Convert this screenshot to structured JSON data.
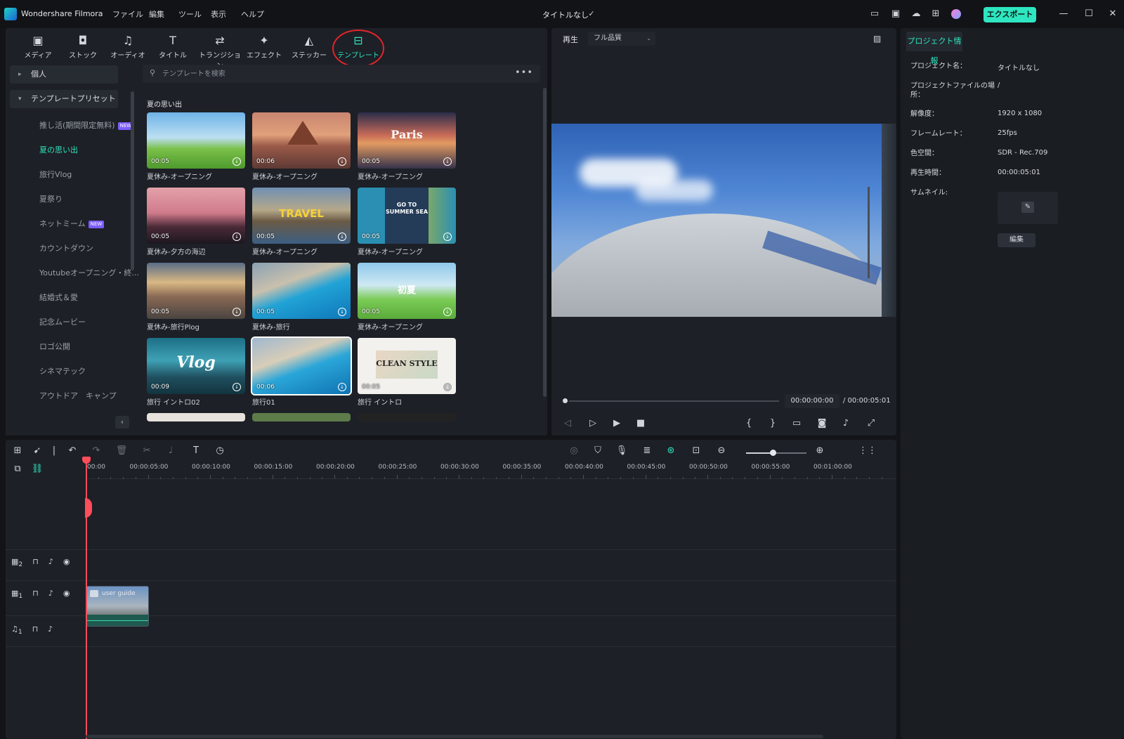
{
  "titlebar": {
    "app_name": "Wondershare Filmora",
    "menu": [
      "ファイル",
      "編集",
      "ツール",
      "表示",
      "ヘルプ"
    ],
    "document_title": "タイトルなし",
    "export_label": "エクスポート",
    "accent_color": "#2ee6c0"
  },
  "media_tools": [
    {
      "label": "メディア",
      "icon": "media-icon"
    },
    {
      "label": "ストック",
      "icon": "stock-icon"
    },
    {
      "label": "オーディオ",
      "icon": "audio-icon"
    },
    {
      "label": "タイトル",
      "icon": "title-icon"
    },
    {
      "label": "トランジション",
      "icon": "transition-icon"
    },
    {
      "label": "エフェクト",
      "icon": "effect-icon"
    },
    {
      "label": "ステッカー",
      "icon": "sticker-icon"
    },
    {
      "label": "テンプレート",
      "icon": "template-icon",
      "active": true
    }
  ],
  "sidebar": {
    "group_personal": "個人",
    "group_presets": "テンプレートプリセット",
    "items": [
      {
        "label": "推し活(期間限定無料)",
        "badge": "NEW"
      },
      {
        "label": "夏の思い出",
        "active": true
      },
      {
        "label": "旅行Vlog"
      },
      {
        "label": "夏祭り"
      },
      {
        "label": "ネットミーム",
        "badge": "NEW"
      },
      {
        "label": "カウントダウン"
      },
      {
        "label": "Youtubeオープニング・終..."
      },
      {
        "label": "結婚式＆愛"
      },
      {
        "label": "記念ムービー"
      },
      {
        "label": "ロゴ公開"
      },
      {
        "label": "シネマテック"
      },
      {
        "label": "アウトドア　キャンプ"
      }
    ]
  },
  "search": {
    "placeholder": "テンプレートを検索"
  },
  "section_title": "夏の思い出",
  "templates": [
    {
      "label": "夏休み-オープニング",
      "duration": "00:05"
    },
    {
      "label": "夏休み-オープニング",
      "duration": "00:06"
    },
    {
      "label": "夏休み-オープニング",
      "duration": "00:05",
      "overlay": "Paris"
    },
    {
      "label": "夏休み-夕方の海辺",
      "duration": "00:05"
    },
    {
      "label": "夏休み-オープニング",
      "duration": "00:05",
      "overlay": "TRAVEL"
    },
    {
      "label": "夏休み-オープニング",
      "duration": "00:05",
      "overlay": "GO TO SUMMER SEA"
    },
    {
      "label": "夏休み-旅行Plog",
      "duration": "00:05"
    },
    {
      "label": "夏休み-旅行",
      "duration": "00:05"
    },
    {
      "label": "夏休み-オープニング",
      "duration": "00:05",
      "overlay": "初夏"
    },
    {
      "label": "旅行 イントロ02",
      "duration": "00:09",
      "overlay": "Vlog"
    },
    {
      "label": "旅行01",
      "duration": "00:06"
    },
    {
      "label": "旅行 イントロ",
      "duration": "00:05",
      "overlay": "CLEAN STYLE"
    }
  ],
  "preview": {
    "label": "再生",
    "quality": "フル品質",
    "current_time": "00:00:00:00",
    "total_time": "/ 00:00:05:01"
  },
  "project_info": {
    "tab": "プロジェクト情報",
    "rows": [
      {
        "key": "プロジェクト名：",
        "value": "タイトルなし"
      },
      {
        "key": "プロジェクトファイルの場所：",
        "value": "/"
      },
      {
        "key": "解像度：",
        "value": "1920 x 1080"
      },
      {
        "key": "フレームレート：",
        "value": "25fps"
      },
      {
        "key": "色空間：",
        "value": "SDR - Rec.709"
      },
      {
        "key": "再生時間：",
        "value": "00:00:05:01"
      },
      {
        "key": "サムネイル:",
        "value": ""
      }
    ],
    "edit_label": "編集"
  },
  "timeline": {
    "ruler": [
      "00:00",
      "00:00:05:00",
      "00:00:10:00",
      "00:00:15:00",
      "00:00:20:00",
      "00:00:25:00",
      "00:00:30:00",
      "00:00:35:00",
      "00:00:40:00",
      "00:00:45:00",
      "00:00:50:00",
      "00:00:55:00",
      "00:01:00:00"
    ],
    "tracks": [
      {
        "type": "video",
        "index": "2"
      },
      {
        "type": "video",
        "index": "1"
      },
      {
        "type": "audio",
        "index": "1"
      }
    ],
    "clip_label": "user guide"
  }
}
